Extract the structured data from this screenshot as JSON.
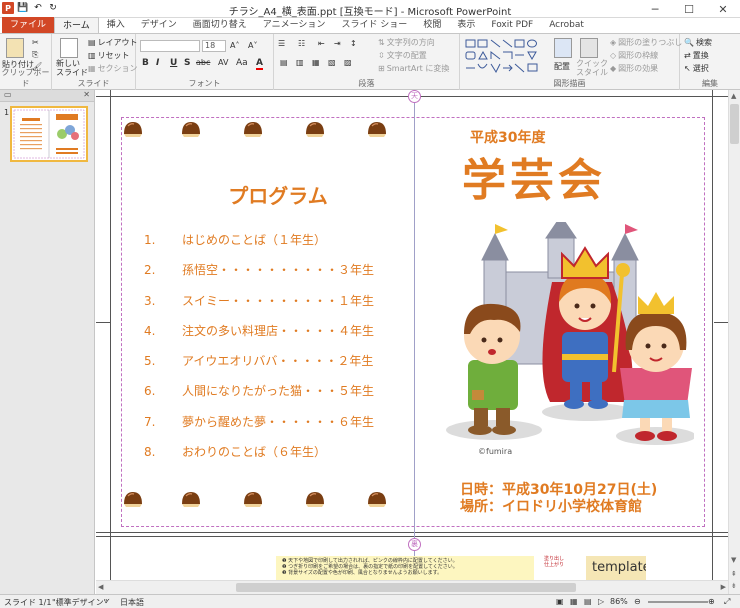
{
  "window": {
    "title": "チラシ_A4_横_表面.ppt [互換モード] - Microsoft PowerPoint"
  },
  "qat": {
    "save": "💾",
    "undo": "↶",
    "redo": "↻"
  },
  "tabs": [
    "ファイル",
    "ホーム",
    "挿入",
    "デザイン",
    "画面切り替え",
    "アニメーション",
    "スライド ショー",
    "校閲",
    "表示",
    "Foxit PDF",
    "Acrobat"
  ],
  "ribbon": {
    "clipboard": {
      "label": "クリップボード",
      "paste": "貼り付け"
    },
    "slides": {
      "label": "スライド",
      "new_slide": "新しい\nスライド",
      "layout": "レイアウト",
      "reset": "リセット",
      "section": "セクション"
    },
    "font": {
      "label": "フォント",
      "size": "18",
      "b": "B",
      "i": "I",
      "u": "U",
      "s": "S",
      "abc": "abc",
      "av": "AV",
      "aa": "Aa",
      "a_color": "A"
    },
    "paragraph": {
      "label": "段落",
      "text_dir": "文字列の方向",
      "align_text": "文字の配置",
      "smartart": "SmartArt に変換"
    },
    "drawing": {
      "label": "図形描画",
      "arrange": "配置",
      "quick_style": "クイック\nスタイル",
      "fill": "図形の塗りつぶし",
      "outline": "図形の枠線",
      "effects": "図形の効果"
    },
    "editing": {
      "label": "編集",
      "find": "検索",
      "replace": "置換",
      "select": "選択"
    }
  },
  "thumb": {
    "number": "1"
  },
  "slide": {
    "program_title": "プログラム",
    "items": [
      {
        "n": "1.",
        "text": "はじめのことば（１年生）"
      },
      {
        "n": "2.",
        "text": "孫悟空・・・・・・・・・・３年生"
      },
      {
        "n": "3.",
        "text": "スイミー・・・・・・・・・１年生"
      },
      {
        "n": "4.",
        "text": "注文の多い料理店・・・・・４年生"
      },
      {
        "n": "5.",
        "text": "アイウエオリババ・・・・・２年生"
      },
      {
        "n": "6.",
        "text": "人間になりたがった猫・・・５年生"
      },
      {
        "n": "7.",
        "text": "夢から醒めた夢・・・・・・６年生"
      },
      {
        "n": "8.",
        "text": "おわりのことば（６年生）"
      }
    ],
    "year": "平成30年度",
    "main_title": "学芸会",
    "credit": "©fumira",
    "date": "日時：平成30年10月27日(土)",
    "place": "場所：イロドリ小学校体育館",
    "top_mark": "天",
    "bottom_mark": "裏"
  },
  "page2": {
    "lines": [
      "❶ 天下や地図で印刷して出力されれば、ピンクの線枠内に配置してください。",
      "❷ つぎ折り印刷をご希望の場合は、裏の指定で紙の印刷を配置してください。",
      "❸ 背景サイズの配置や色が印刷、風合となりませんようお願いします。"
    ],
    "label": "template",
    "side_note": "塗り出し\n仕上がり"
  },
  "status": {
    "slide": "スライド 1/1",
    "theme": "\"標準デザイン\"",
    "lang": "日本語",
    "zoom": "86%"
  },
  "colors": {
    "accent": "#e07b22",
    "file_tab": "#d24726"
  }
}
